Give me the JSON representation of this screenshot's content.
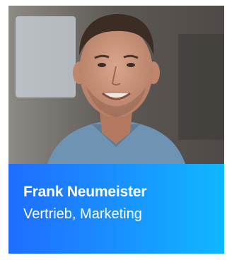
{
  "person": {
    "name": "Frank Neumeister",
    "role": "Vertrieb, Marketing"
  },
  "colors": {
    "caption_gradient_start": "#1f6dff",
    "caption_gradient_end": "#10b8ff",
    "text": "#ffffff"
  }
}
